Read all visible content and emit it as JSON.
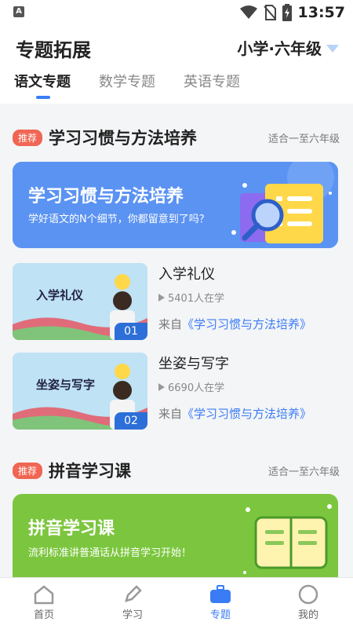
{
  "statusbar": {
    "left_icon": "A",
    "time": "13:57"
  },
  "header": {
    "title": "专题拓展",
    "grade": "小学·六年级"
  },
  "tabs": [
    {
      "label": "语文专题",
      "active": true
    },
    {
      "label": "数学专题",
      "active": false
    },
    {
      "label": "英语专题",
      "active": false
    }
  ],
  "sections": [
    {
      "tag": "推荐",
      "title": "学习习惯与方法培养",
      "suitable": "适合一至六年级",
      "banner": {
        "title": "学习习惯与方法培养",
        "subtitle": "学好语文的N个细节，你都留意到了吗？"
      },
      "courses": [
        {
          "thumb_label": "入学礼仪",
          "index": "01",
          "name": "入学礼仪",
          "count": "5401人在学",
          "from_prefix": "来自",
          "from_link": "《学习习惯与方法培养》"
        },
        {
          "thumb_label": "坐姿与写字",
          "index": "02",
          "name": "坐姿与写字",
          "count": "6690人在学",
          "from_prefix": "来自",
          "from_link": "《学习习惯与方法培养》"
        }
      ]
    },
    {
      "tag": "推荐",
      "title": "拼音学习课",
      "suitable": "适合一至六年级",
      "banner": {
        "title": "拼音学习课",
        "subtitle": "流利标准讲普通话从拼音学习开始！"
      }
    }
  ],
  "nav": [
    {
      "label": "首页",
      "icon": "home-icon"
    },
    {
      "label": "学习",
      "icon": "pen-icon"
    },
    {
      "label": "专题",
      "icon": "briefcase-icon"
    },
    {
      "label": "我的",
      "icon": "user-icon"
    }
  ],
  "colors": {
    "accent": "#3a7cf6",
    "tag": "#f06553",
    "banner1": "#5b93f2",
    "banner2": "#7cc63f"
  }
}
